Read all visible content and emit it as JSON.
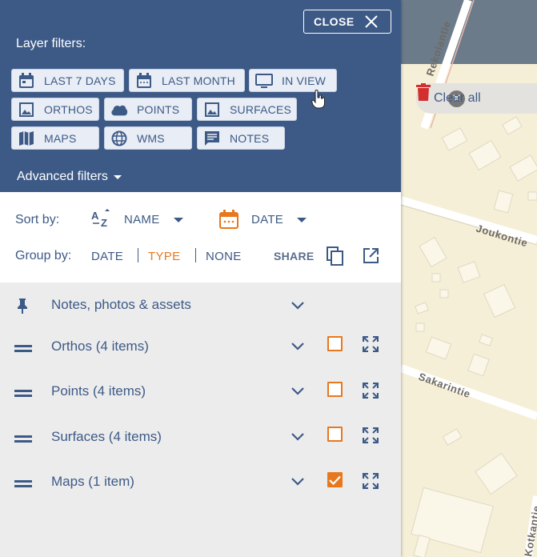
{
  "map": {
    "streets": [
      "Rekolantie",
      "Joukontie",
      "Sakarintie",
      "Kotkantie"
    ],
    "clear_all_label": "Clear all"
  },
  "panel": {
    "close_label": "CLOSE",
    "layer_filters_title": "Layer filters:",
    "filter_chips": [
      {
        "label": "LAST 7 DAYS",
        "icon": "calendar-icon"
      },
      {
        "label": "LAST MONTH",
        "icon": "calendar-icon"
      },
      {
        "label": "IN VIEW",
        "icon": "monitor-icon"
      },
      {
        "label": "ORTHOS",
        "icon": "image-icon"
      },
      {
        "label": "POINTS",
        "icon": "cloud-icon"
      },
      {
        "label": "SURFACES",
        "icon": "image-icon"
      },
      {
        "label": "MAPS",
        "icon": "map-icon"
      },
      {
        "label": "WMS",
        "icon": "globe-icon"
      },
      {
        "label": "NOTES",
        "icon": "note-icon"
      }
    ],
    "advanced_filters_label": "Advanced filters",
    "sort_by_label": "Sort by:",
    "sort_options": [
      {
        "label": "NAME",
        "icon": "sort-az-icon"
      },
      {
        "label": "DATE",
        "icon": "calendar-icon"
      }
    ],
    "group_by_label": "Group by:",
    "group_options": [
      {
        "label": "DATE",
        "active": false
      },
      {
        "label": "TYPE",
        "active": true
      },
      {
        "label": "NONE",
        "active": false
      }
    ],
    "share_label": "SHARE",
    "layer_groups": [
      {
        "label": "Notes, photos & assets",
        "pinned": true
      },
      {
        "label": "Orthos (4 items)",
        "checked": false
      },
      {
        "label": "Points (4 items)",
        "checked": false
      },
      {
        "label": "Surfaces (4 items)",
        "checked": false
      },
      {
        "label": "Maps (1 item)",
        "checked": true
      }
    ]
  },
  "colors": {
    "header_bg": "#3d5a87",
    "accent_orange": "#e8781e",
    "chip_bg": "#e9edf5",
    "list_bg": "#ececec"
  }
}
